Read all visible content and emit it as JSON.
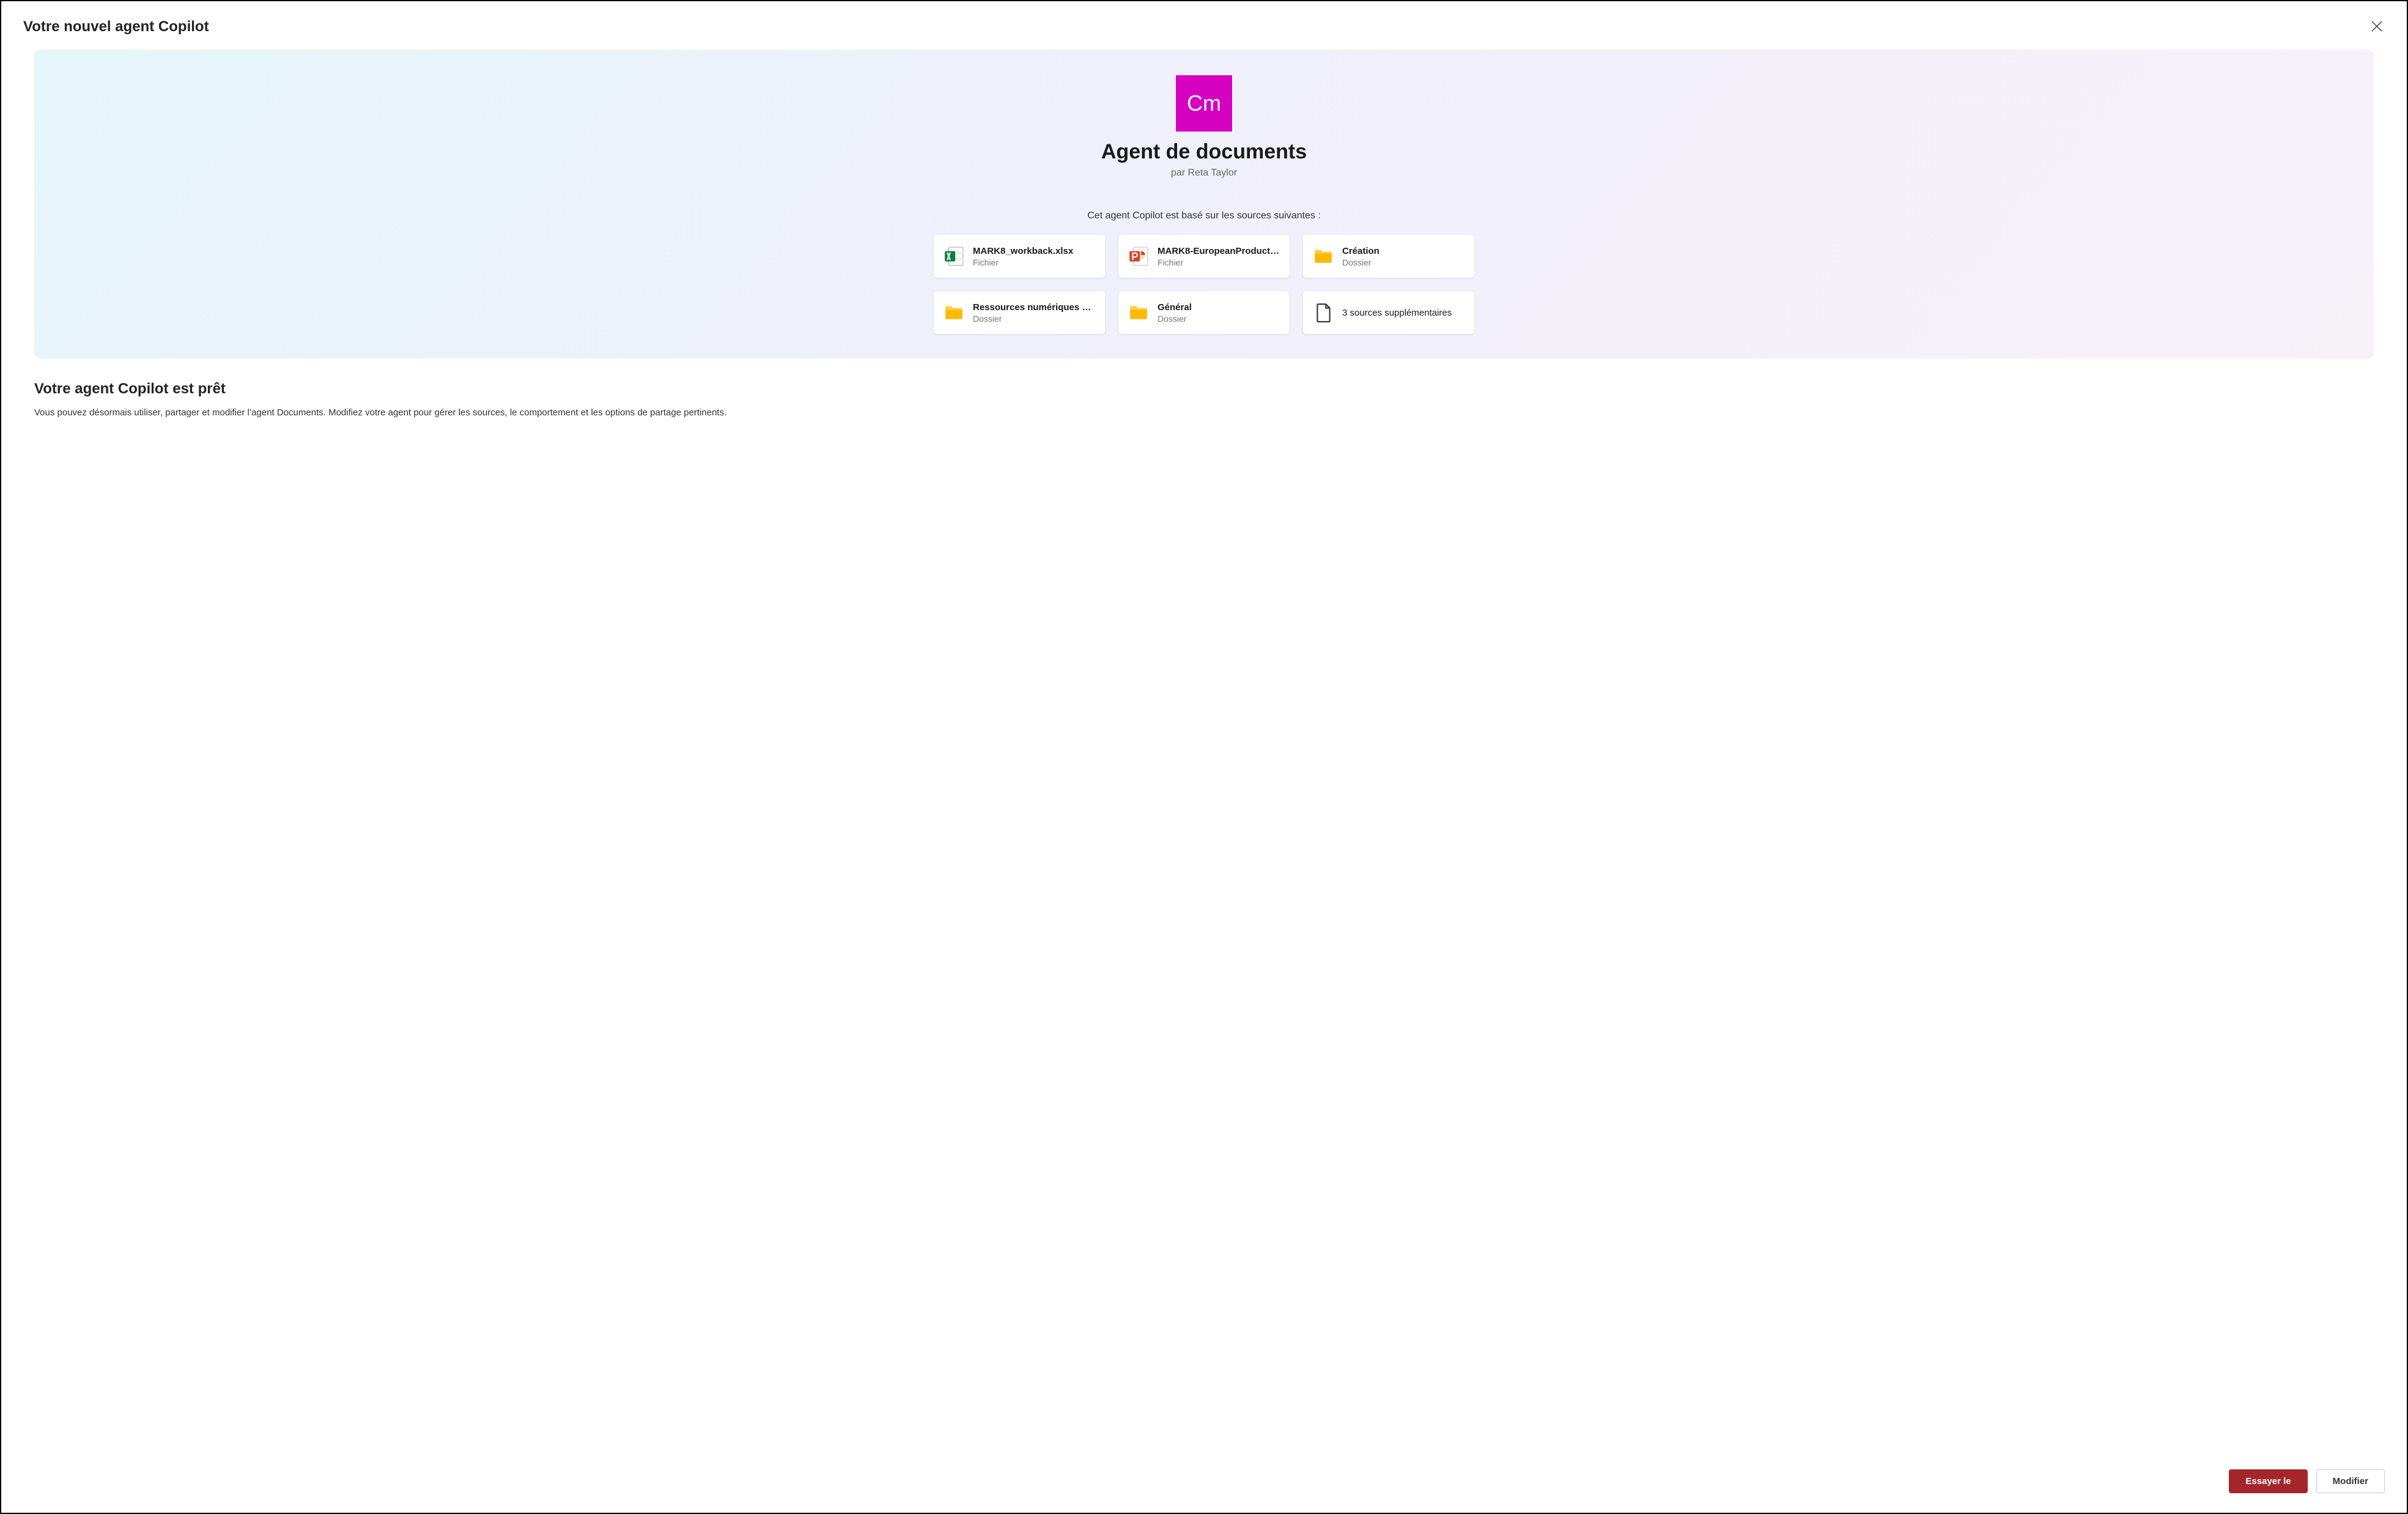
{
  "header": {
    "title": "Votre nouvel agent Copilot"
  },
  "agent": {
    "tile_text": "Cm",
    "tile_color": "#d600c0",
    "name": "Agent de documents",
    "author_line": "par Reta Taylor",
    "sources_caption": "Cet agent Copilot est basé sur les sources suivantes :"
  },
  "sources": [
    {
      "title": "MARK8_workback.xlsx",
      "subtitle": "Fichier",
      "icon": "excel"
    },
    {
      "title": "MARK8-EuropeanProduct…",
      "subtitle": "Fichier",
      "icon": "powerpoint"
    },
    {
      "title": "Création",
      "subtitle": "Dossier",
      "icon": "folder"
    },
    {
      "title": "Ressources numériques W…",
      "subtitle": "Dossier",
      "icon": "folder"
    },
    {
      "title": "Général",
      "subtitle": "Dossier",
      "icon": "folder"
    },
    {
      "title": "3 sources supplémentaires",
      "subtitle": "",
      "icon": "file"
    }
  ],
  "ready": {
    "title": "Votre agent Copilot est prêt",
    "body": "Vous pouvez désormais utiliser, partager et modifier l’agent Documents. Modifiez votre agent pour gérer les sources, le comportement et les options de partage pertinents."
  },
  "footer": {
    "primary": "Essayer le",
    "secondary": "Modifier"
  }
}
